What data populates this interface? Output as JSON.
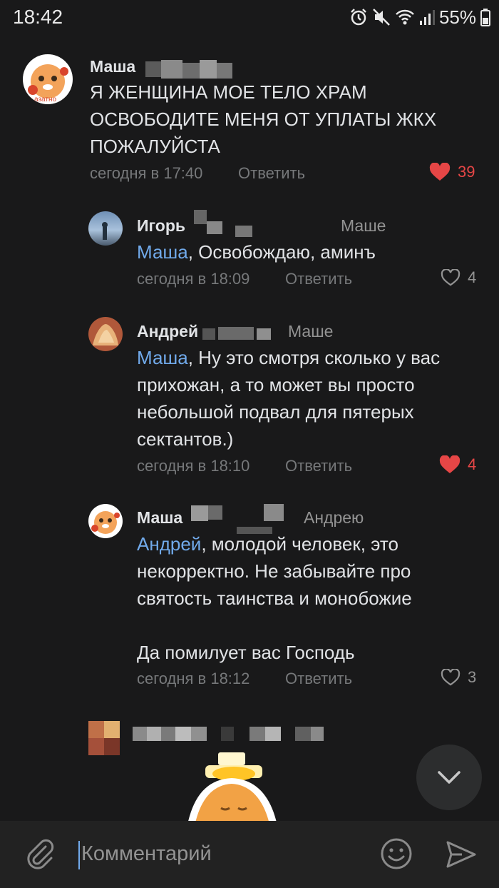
{
  "status": {
    "time": "18:42",
    "battery": "55%"
  },
  "comments": [
    {
      "author": "Маша",
      "text_lines": [
        "Я ЖЕНЩИНА МОЕ ТЕЛО ХРАМ",
        "ОСВОБОДИТЕ МЕНЯ ОТ УПЛАТЫ  ЖКХ",
        "ПОЖАЛУЙСТА"
      ],
      "time": "сегодня в 17:40",
      "reply_label": "Ответить",
      "likes": "39",
      "liked": true
    },
    {
      "author": "Игорь",
      "reply_to": "Маше",
      "mention": "Маша",
      "text": ", Освобождаю, аминъ",
      "time": "сегодня в 18:09",
      "reply_label": "Ответить",
      "likes": "4",
      "liked": false
    },
    {
      "author": "Андрей",
      "reply_to": "Маше",
      "mention": "Маша",
      "text_lines": [
        ", Ну это смотря сколько у вас",
        "прихожан, а то может вы просто",
        "небольшой подвал для пятерых",
        "сектантов.)"
      ],
      "time": "сегодня в 18:10",
      "reply_label": "Ответить",
      "likes": "4",
      "liked": true
    },
    {
      "author": "Маша",
      "reply_to": "Андрею",
      "mention": "Андрей",
      "text_lines": [
        ", молодой человек, это",
        "некорректно. Не забывайте про",
        "святость  таинства и монобожие",
        "",
        "Да помилует вас Господь"
      ],
      "time": "сегодня в 18:12",
      "reply_label": "Ответить",
      "likes": "3",
      "liked": false
    }
  ],
  "composer": {
    "placeholder": "Комментарий"
  },
  "colors": {
    "accent": "#71aaeb",
    "like_active": "#e64646",
    "background": "#19191a"
  }
}
